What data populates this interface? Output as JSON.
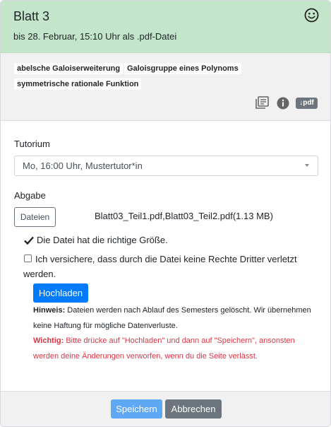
{
  "header": {
    "title": "Blatt 3",
    "deadline": "bis 28. Februar, 15:10 Uhr als .pdf-Datei",
    "status_icon": "smiley-icon",
    "bg_color": "#c3e6cb"
  },
  "tags": [
    "abelsche Galoiserweiterung",
    "Galoisgruppe eines Polynoms",
    "symmetrische rationale Funktion"
  ],
  "tools": {
    "icons": [
      "book-icon",
      "info-icon"
    ],
    "pdf_label": "↓pdf"
  },
  "form": {
    "tutorium_label": "Tutorium",
    "tutorium_value": "Mo, 16:00 Uhr, Mustertutor*in",
    "abgabe_label": "Abgabe",
    "files_button": "Dateien",
    "file_names": "Blatt03_Teil1.pdf,Blatt03_Teil2.pdf(1.13 MB)",
    "size_ok": "Die Datei hat die richtige Größe.",
    "confirm_text": "Ich versichere, dass durch die Datei keine Rechte Dritter verletzt werden.",
    "upload_button": "Hochladen",
    "hint_label": "Hinweis:",
    "hint_text": " Dateien werden nach Ablauf des Semesters gelöscht. Wir übernehmen keine Haftung für mögliche Datenverluste.",
    "warn_label": "Wichtig:",
    "warn_text": " Bitte drücke auf \"Hochladen\" und dann auf \"Speichern\", ansonsten werden deine Änderungen verworfen, wenn du die Seite verlässt."
  },
  "footer": {
    "save_button": "Speichern",
    "cancel_button": "Abbrechen"
  },
  "colors": {
    "primary": "#007bff",
    "danger": "#dc3545",
    "secondary": "#6c757d"
  }
}
